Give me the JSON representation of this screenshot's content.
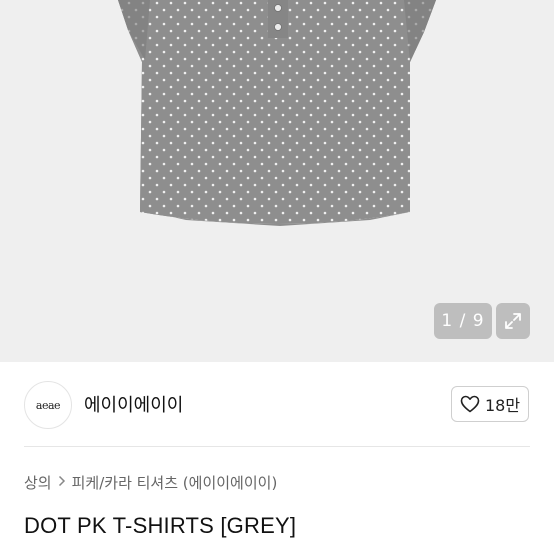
{
  "gallery": {
    "counter": "1 / 9",
    "expand_icon": "expand-arrows-icon"
  },
  "shop": {
    "logo_text": "aeae",
    "name": "에이이에이이",
    "like_icon": "heart-icon",
    "like_count": "18만"
  },
  "breadcrumb": {
    "category": "상의",
    "separator_icon": "chevron-right-icon",
    "subcategory": "피케/카라 티셔츠 (에이이에이이)"
  },
  "product": {
    "title": "DOT PK T-SHIRTS [GREY]"
  },
  "colors": {
    "hero_bg": "#efefef",
    "shirt": "#8e8e8e",
    "dot": "#f2f2f2"
  }
}
